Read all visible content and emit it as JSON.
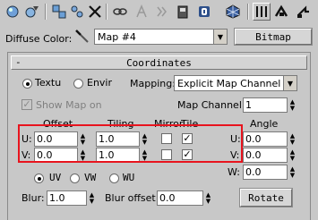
{
  "toolbar": {
    "icons": [
      "get-material-icon",
      "put-to-scene-icon",
      "assign-to-selection-icon",
      "reset-map-icon",
      "delete-icon",
      "make-unique-icon",
      "put-to-library-icon",
      "material-effects-channel-icon",
      "show-map-in-viewport-icon",
      "show-end-result-icon",
      "go-to-parent-icon",
      "go-forward-icon"
    ]
  },
  "header": {
    "diffuse_label": "Diffuse Color:",
    "map_name": "Map #4",
    "map_type_button": "Bitmap"
  },
  "coordinates": {
    "title": "Coordinates",
    "collapse_glyph": "-",
    "texture_label": "Textu",
    "environ_label": "Envir",
    "mapping_label": "Mapping:",
    "mapping_value": "Explicit Map Channel",
    "show_map_on_label": "Show Map on",
    "map_channel_label": "Map Channel:",
    "map_channel_value": "1",
    "offset_header": "Offset",
    "tiling_header": "Tiling",
    "mirror_header": "Mirror",
    "tile_header": "Tile",
    "angle_header": "Angle",
    "u_label": "U:",
    "v_label": "V:",
    "w_label": "W:",
    "u_offset": "0.0",
    "v_offset": "0.0",
    "u_tiling": "1.0",
    "v_tiling": "1.0",
    "u_angle": "0.0",
    "v_angle": "0.0",
    "w_angle": "0.0",
    "uv_label": "UV",
    "vw_label": "VW",
    "wu_label": "WU",
    "blur_label": "Blur:",
    "blur_value": "1.0",
    "blur_offset_label": "Blur offset:",
    "blur_offset_value": "0.0",
    "rotate_button": "Rotate",
    "checked_mark": "✓"
  },
  "colors": {
    "highlight": "#e8141e",
    "panel": "#c8c8c8"
  }
}
